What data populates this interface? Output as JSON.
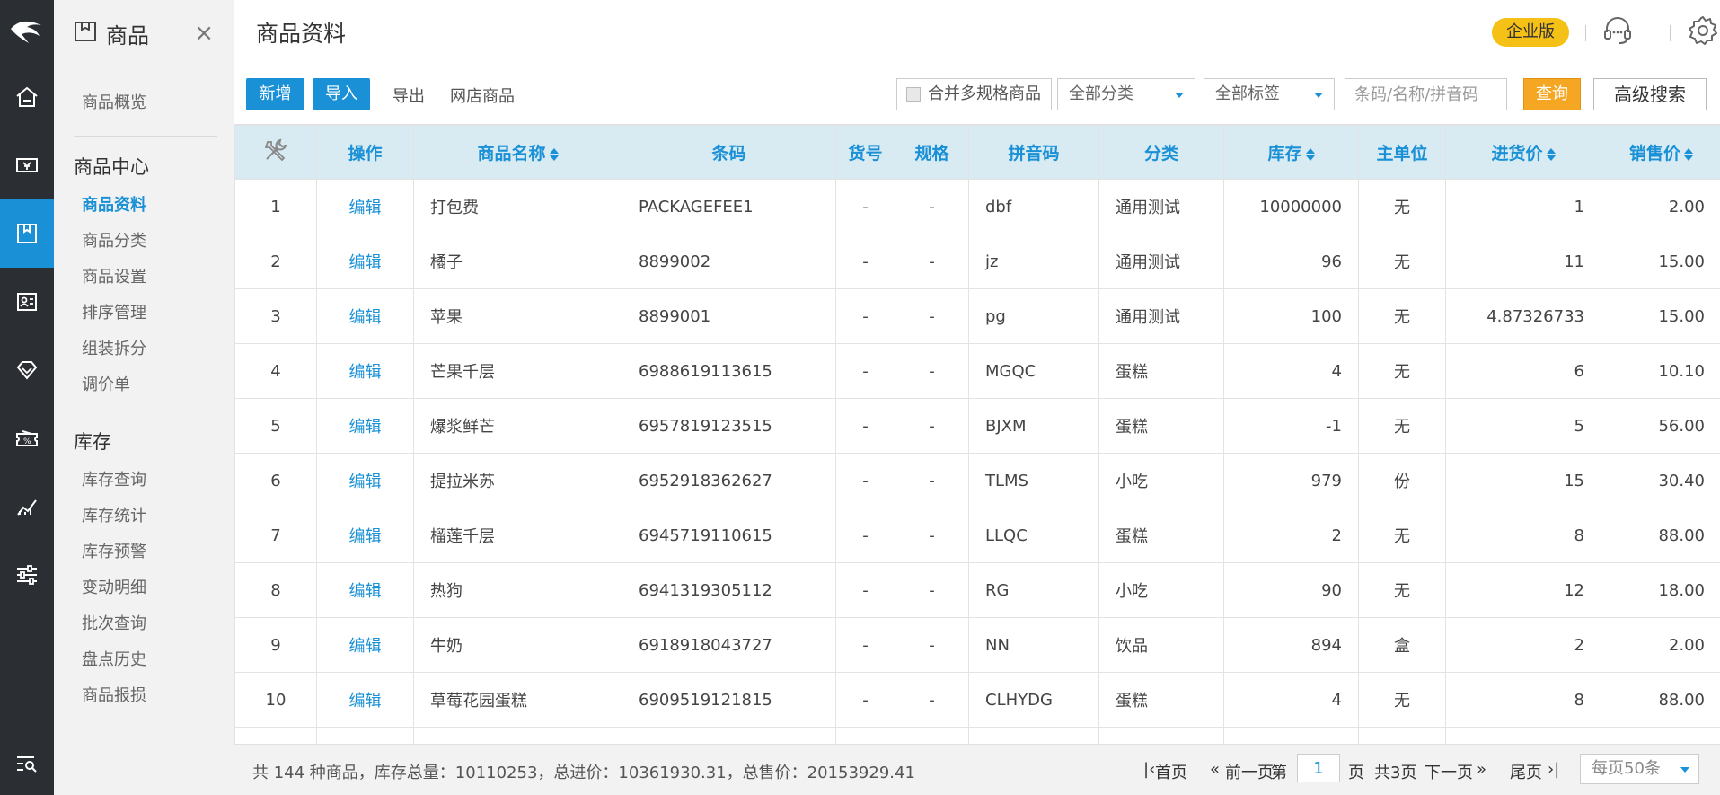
{
  "sidebar": {
    "title": "商品",
    "close": "×",
    "first_item": "商品概览",
    "group_center": "商品中心",
    "center_items": [
      {
        "label": "商品资料",
        "active": true
      },
      {
        "label": "商品分类"
      },
      {
        "label": "商品设置"
      },
      {
        "label": "排序管理"
      },
      {
        "label": "组装拆分"
      },
      {
        "label": "调价单"
      }
    ],
    "group_stock": "库存",
    "stock_items": [
      {
        "label": "库存查询"
      },
      {
        "label": "库存统计"
      },
      {
        "label": "库存预警"
      },
      {
        "label": "变动明细"
      },
      {
        "label": "批次查询"
      },
      {
        "label": "盘点历史"
      },
      {
        "label": "商品报损"
      }
    ]
  },
  "header": {
    "title": "商品资料",
    "edition_badge": "企业版"
  },
  "toolbar": {
    "add_label": "新增",
    "import_label": "导入",
    "export_label": "导出",
    "online_label": "网店商品",
    "merge_label": "合并多规格商品",
    "category_select": "全部分类",
    "tag_select": "全部标签",
    "search_placeholder": "条码/名称/拼音码",
    "query_label": "查询",
    "advanced_label": "高级搜索"
  },
  "table": {
    "headers": [
      "操作",
      "商品名称",
      "条码",
      "货号",
      "规格",
      "拼音码",
      "分类",
      "库存",
      "主单位",
      "进货价",
      "销售价"
    ],
    "edit_label": "编辑",
    "rows": [
      {
        "idx": "1",
        "name": "打包费",
        "barcode": "PACKAGEFEE1",
        "sku": "-",
        "spec": "-",
        "pinyin": "dbf",
        "category": "通用测试",
        "stock": "10000000",
        "unit": "无",
        "cost": "1",
        "price": "2.00"
      },
      {
        "idx": "2",
        "name": "橘子",
        "barcode": "8899002",
        "sku": "-",
        "spec": "-",
        "pinyin": "jz",
        "category": "通用测试",
        "stock": "96",
        "unit": "无",
        "cost": "11",
        "price": "15.00"
      },
      {
        "idx": "3",
        "name": "苹果",
        "barcode": "8899001",
        "sku": "-",
        "spec": "-",
        "pinyin": "pg",
        "category": "通用测试",
        "stock": "100",
        "unit": "无",
        "cost": "4.87326733",
        "price": "15.00"
      },
      {
        "idx": "4",
        "name": "芒果千层",
        "barcode": "6988619113615",
        "sku": "-",
        "spec": "-",
        "pinyin": "MGQC",
        "category": "蛋糕",
        "stock": "4",
        "unit": "无",
        "cost": "6",
        "price": "10.10"
      },
      {
        "idx": "5",
        "name": "爆浆鲜芒",
        "barcode": "6957819123515",
        "sku": "-",
        "spec": "-",
        "pinyin": "BJXM",
        "category": "蛋糕",
        "stock": "-1",
        "unit": "无",
        "cost": "5",
        "price": "56.00"
      },
      {
        "idx": "6",
        "name": "提拉米苏",
        "barcode": "6952918362627",
        "sku": "-",
        "spec": "-",
        "pinyin": "TLMS",
        "category": "小吃",
        "stock": "979",
        "unit": "份",
        "cost": "15",
        "price": "30.40"
      },
      {
        "idx": "7",
        "name": "榴莲千层",
        "barcode": "6945719110615",
        "sku": "-",
        "spec": "-",
        "pinyin": "LLQC",
        "category": "蛋糕",
        "stock": "2",
        "unit": "无",
        "cost": "8",
        "price": "88.00"
      },
      {
        "idx": "8",
        "name": "热狗",
        "barcode": "6941319305112",
        "sku": "-",
        "spec": "-",
        "pinyin": "RG",
        "category": "小吃",
        "stock": "90",
        "unit": "无",
        "cost": "12",
        "price": "18.00"
      },
      {
        "idx": "9",
        "name": "牛奶",
        "barcode": "6918918043727",
        "sku": "-",
        "spec": "-",
        "pinyin": "NN",
        "category": "饮品",
        "stock": "894",
        "unit": "盒",
        "cost": "2",
        "price": "2.00"
      },
      {
        "idx": "10",
        "name": "草莓花园蛋糕",
        "barcode": "6909519121815",
        "sku": "-",
        "spec": "-",
        "pinyin": "CLHYDG",
        "category": "蛋糕",
        "stock": "4",
        "unit": "无",
        "cost": "8",
        "price": "88.00"
      }
    ]
  },
  "footer": {
    "summary": "共 144 种商品，库存总量：10110253，总进价：10361930.31，总售价：20153929.41",
    "first_page": "首页",
    "prev_page": "前一页",
    "page_prefix": "第",
    "page_value": "1",
    "page_suffix": "页",
    "total_pages": "共3页",
    "next_page": "下一页",
    "last_page": "尾页",
    "per_page": "每页50条"
  },
  "colors": {
    "accent": "#1a90d6",
    "rail_bg": "#2b2e33",
    "badge": "#f5c117",
    "query": "#f5a623",
    "header_bg": "#d8ebf3"
  }
}
